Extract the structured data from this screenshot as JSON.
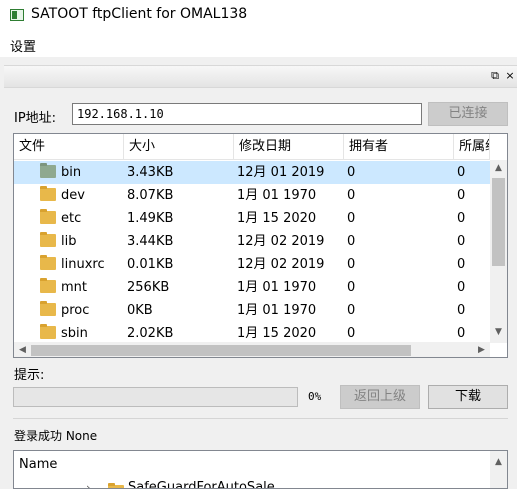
{
  "window": {
    "title": "SATOOT ftpClient for OMAL138"
  },
  "menu": {
    "settings": "设置"
  },
  "dock": {
    "float_glyph": "⧉",
    "close_glyph": "×"
  },
  "connection": {
    "ip_label": "IP地址:",
    "ip_value": "192.168.1.10",
    "connect_button": "已连接"
  },
  "remote": {
    "columns": [
      "文件",
      "大小",
      "修改日期",
      "拥有者",
      "所属组"
    ],
    "rows": [
      {
        "name": "bin",
        "size": "3.43KB",
        "date": "12月 01 2019",
        "owner": "0",
        "group": "0",
        "selected": true
      },
      {
        "name": "dev",
        "size": "8.07KB",
        "date": "1月 01 1970",
        "owner": "0",
        "group": "0"
      },
      {
        "name": "etc",
        "size": "1.49KB",
        "date": "1月 15 2020",
        "owner": "0",
        "group": "0"
      },
      {
        "name": "lib",
        "size": "3.44KB",
        "date": "12月 02 2019",
        "owner": "0",
        "group": "0"
      },
      {
        "name": "linuxrc",
        "size": "0.01KB",
        "date": "12月 02 2019",
        "owner": "0",
        "group": "0"
      },
      {
        "name": "mnt",
        "size": "256KB",
        "date": "1月 01 1970",
        "owner": "0",
        "group": "0"
      },
      {
        "name": "proc",
        "size": "0KB",
        "date": "1月 01 1970",
        "owner": "0",
        "group": "0"
      },
      {
        "name": "sbin",
        "size": "2.02KB",
        "date": "1月 15 2020",
        "owner": "0",
        "group": "0"
      }
    ]
  },
  "status": {
    "hint_label": "提示:",
    "progress_percent": "0%",
    "progress_value": 0,
    "back_button": "返回上级",
    "download_button": "下载",
    "login_message": "登录成功 None"
  },
  "local": {
    "name_header": "Name",
    "first_item": "SafeGuardForAutoSale"
  },
  "colors": {
    "selected_row": "#cce8ff",
    "folder": "#e8b84a",
    "disabled_button": "#cccccc"
  }
}
